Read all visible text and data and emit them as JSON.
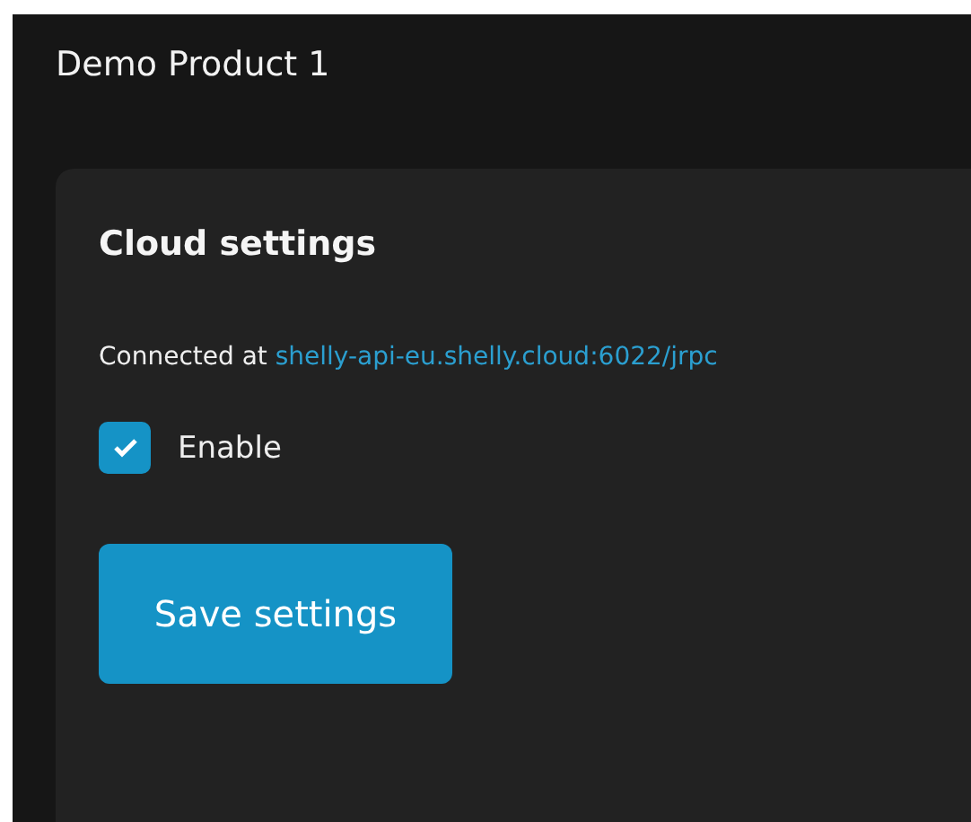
{
  "page": {
    "title": "Demo Product 1"
  },
  "cloud": {
    "heading": "Cloud settings",
    "status_label": "Connected at",
    "server_link": "shelly-api-eu.shelly.cloud:6022/jrpc",
    "enable": {
      "label": "Enable",
      "checked": true
    },
    "save_button": "Save settings"
  }
}
